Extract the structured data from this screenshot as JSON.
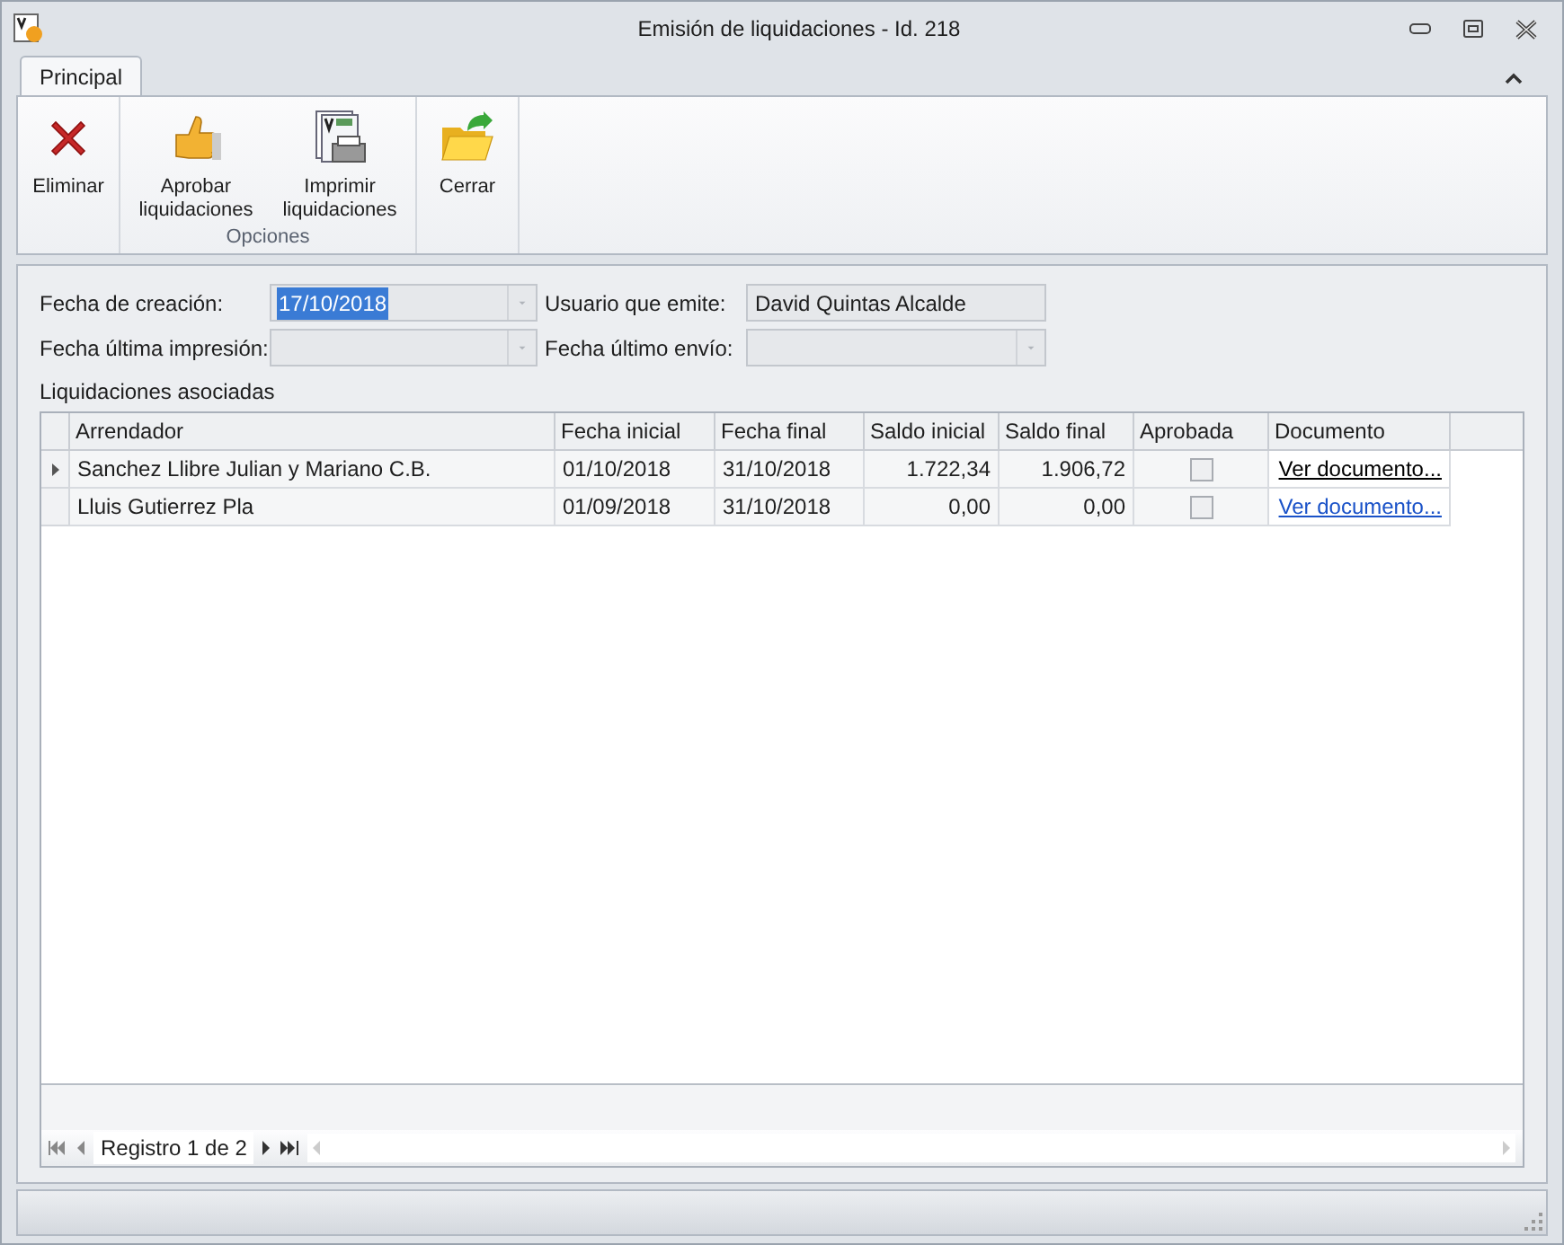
{
  "window": {
    "title": "Emisión de liquidaciones - Id. 218"
  },
  "tabs": [
    {
      "label": "Principal",
      "selected": true
    }
  ],
  "ribbon": {
    "groups": [
      {
        "buttons": [
          {
            "label": "Eliminar"
          }
        ]
      },
      {
        "label": "Opciones",
        "buttons": [
          {
            "label": "Aprobar liquidaciones"
          },
          {
            "label": "Imprimir liquidaciones"
          }
        ]
      },
      {
        "buttons": [
          {
            "label": "Cerrar"
          }
        ]
      }
    ]
  },
  "fields": [
    {
      "label": "Fecha de creación:",
      "value": "17/10/2018",
      "kind": "dropdown",
      "highlighted": true
    },
    {
      "label": "Usuario que emite:",
      "value": "David Quintas Alcalde",
      "kind": "text",
      "highlighted": false
    },
    {
      "label": "Fecha última impresión:",
      "kind": "dropdown"
    },
    {
      "label": "Fecha último envío:",
      "kind": "dropdown"
    }
  ],
  "grid": {
    "title": "Liquidaciones asociadas",
    "columns": [
      "Arrendador",
      "Fecha inicial",
      "Fecha final",
      "Saldo inicial",
      "Saldo final",
      "Aprobada",
      "Documento"
    ],
    "rows": [
      {
        "selected": true,
        "cells": [
          "Sanchez Llibre Julian y Mariano C.B.",
          "01/10/2018",
          "31/10/2018",
          "1.722,34",
          "1.906,72"
        ],
        "approved": false,
        "link": "Ver documento..."
      },
      {
        "selected": false,
        "cells": [
          "Lluis Gutierrez Pla",
          "01/09/2018",
          "31/10/2018",
          "0,00",
          "0,00"
        ],
        "approved": false,
        "link": "Ver documento..."
      }
    ]
  },
  "pager": {
    "text": "Registro 1 de 2"
  }
}
